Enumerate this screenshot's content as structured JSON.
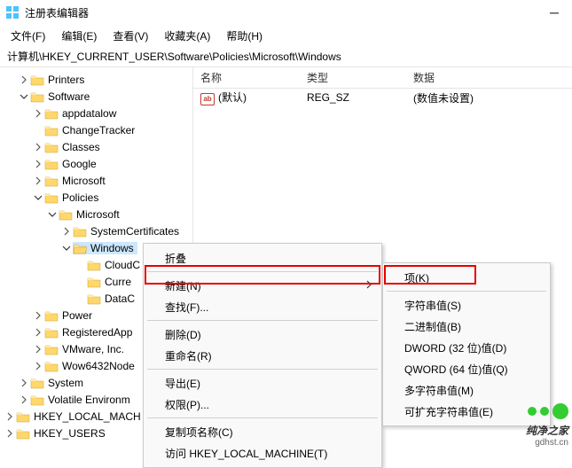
{
  "window": {
    "title": "注册表编辑器"
  },
  "menubar": [
    "文件(F)",
    "编辑(E)",
    "查看(V)",
    "收藏夹(A)",
    "帮助(H)"
  ],
  "path": "计算机\\HKEY_CURRENT_USER\\Software\\Policies\\Microsoft\\Windows",
  "tree": [
    {
      "indent": 1,
      "chev": "right",
      "type": "folder",
      "label": "Printers"
    },
    {
      "indent": 1,
      "chev": "down",
      "type": "folder",
      "label": "Software"
    },
    {
      "indent": 2,
      "chev": "right",
      "type": "folder",
      "label": "appdatalow"
    },
    {
      "indent": 2,
      "chev": "none",
      "type": "folder",
      "label": "ChangeTracker"
    },
    {
      "indent": 2,
      "chev": "right",
      "type": "folder",
      "label": "Classes"
    },
    {
      "indent": 2,
      "chev": "right",
      "type": "folder",
      "label": "Google"
    },
    {
      "indent": 2,
      "chev": "right",
      "type": "folder",
      "label": "Microsoft"
    },
    {
      "indent": 2,
      "chev": "down",
      "type": "folder",
      "label": "Policies"
    },
    {
      "indent": 3,
      "chev": "down",
      "type": "folder",
      "label": "Microsoft"
    },
    {
      "indent": 4,
      "chev": "right",
      "type": "folder",
      "label": "SystemCertificates"
    },
    {
      "indent": 4,
      "chev": "down",
      "type": "folder-open",
      "label": "Windows",
      "selected": true
    },
    {
      "indent": 5,
      "chev": "none",
      "type": "folder",
      "label": "CloudC"
    },
    {
      "indent": 5,
      "chev": "none",
      "type": "folder",
      "label": "Curre"
    },
    {
      "indent": 5,
      "chev": "none",
      "type": "folder",
      "label": "DataC"
    },
    {
      "indent": 2,
      "chev": "right",
      "type": "folder",
      "label": "Power"
    },
    {
      "indent": 2,
      "chev": "right",
      "type": "folder",
      "label": "RegisteredApp"
    },
    {
      "indent": 2,
      "chev": "right",
      "type": "folder",
      "label": "VMware, Inc."
    },
    {
      "indent": 2,
      "chev": "right",
      "type": "folder",
      "label": "Wow6432Node"
    },
    {
      "indent": 1,
      "chev": "right",
      "type": "folder",
      "label": "System"
    },
    {
      "indent": 1,
      "chev": "right",
      "type": "folder",
      "label": "Volatile Environm"
    },
    {
      "indent": 0,
      "chev": "right",
      "type": "folder",
      "label": "HKEY_LOCAL_MACH"
    },
    {
      "indent": 0,
      "chev": "right",
      "type": "folder",
      "label": "HKEY_USERS"
    }
  ],
  "list": {
    "columns": {
      "name": "名称",
      "type": "类型",
      "data": "数据"
    },
    "rows": [
      {
        "name": "(默认)",
        "type": "REG_SZ",
        "data": "(数值未设置)"
      }
    ]
  },
  "ctx1": [
    {
      "label": "折叠",
      "kind": "item"
    },
    {
      "kind": "sep"
    },
    {
      "label": "新建(N)",
      "kind": "item",
      "submenu": true,
      "hl": true
    },
    {
      "label": "查找(F)...",
      "kind": "item"
    },
    {
      "kind": "sep"
    },
    {
      "label": "删除(D)",
      "kind": "item"
    },
    {
      "label": "重命名(R)",
      "kind": "item"
    },
    {
      "kind": "sep"
    },
    {
      "label": "导出(E)",
      "kind": "item"
    },
    {
      "label": "权限(P)...",
      "kind": "item"
    },
    {
      "kind": "sep"
    },
    {
      "label": "复制项名称(C)",
      "kind": "item"
    },
    {
      "label": "访问 HKEY_LOCAL_MACHINE(T)",
      "kind": "item"
    }
  ],
  "ctx2": [
    {
      "label": "项(K)",
      "kind": "item",
      "hl": true
    },
    {
      "kind": "sep"
    },
    {
      "label": "字符串值(S)",
      "kind": "item"
    },
    {
      "label": "二进制值(B)",
      "kind": "item"
    },
    {
      "label": "DWORD (32 位)值(D)",
      "kind": "item"
    },
    {
      "label": "QWORD (64 位)值(Q)",
      "kind": "item"
    },
    {
      "label": "多字符串值(M)",
      "kind": "item"
    },
    {
      "label": "可扩充字符串值(E)",
      "kind": "item"
    }
  ],
  "watermark": {
    "line1": "纯净之家",
    "line2": "gdhst.cn"
  }
}
